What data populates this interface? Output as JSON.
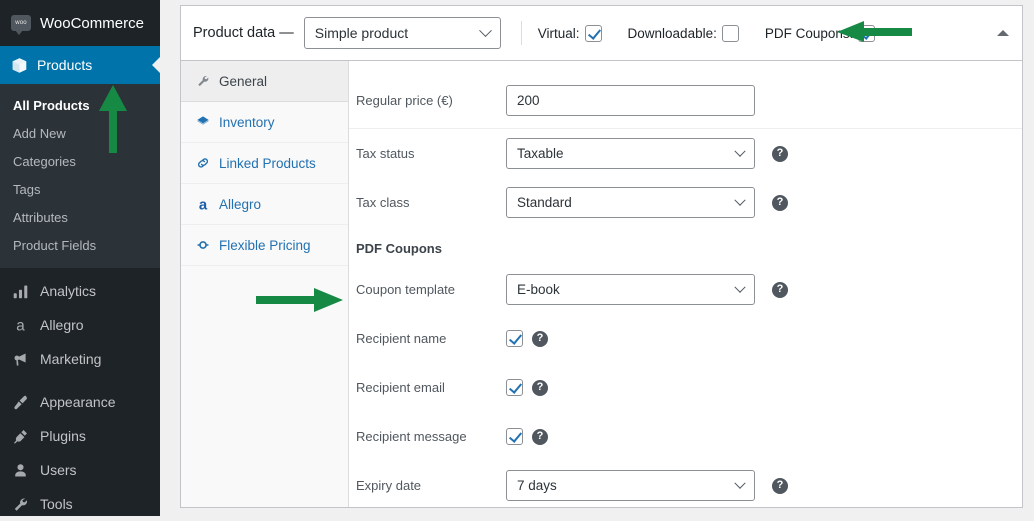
{
  "sidebar": {
    "brand": {
      "label": "WooCommerce",
      "icon": "woo-logo",
      "logo_text": "woo"
    },
    "products": {
      "label": "Products",
      "icon": "cube-icon"
    },
    "submenu": [
      {
        "label": "All Products",
        "current": true
      },
      {
        "label": "Add New",
        "current": false
      },
      {
        "label": "Categories",
        "current": false
      },
      {
        "label": "Tags",
        "current": false
      },
      {
        "label": "Attributes",
        "current": false
      },
      {
        "label": "Product Fields",
        "current": false
      }
    ],
    "items": [
      {
        "label": "Analytics",
        "icon": "bar-chart-icon"
      },
      {
        "label": "Allegro",
        "icon": "allegro-a-icon"
      },
      {
        "label": "Marketing",
        "icon": "megaphone-icon"
      },
      {
        "label": "Appearance",
        "icon": "paintbrush-icon"
      },
      {
        "label": "Plugins",
        "icon": "plug-icon"
      },
      {
        "label": "Users",
        "icon": "user-icon"
      },
      {
        "label": "Tools",
        "icon": "wrench-icon"
      }
    ]
  },
  "panel": {
    "header": {
      "title": "Product data —",
      "product_type": "Simple product",
      "checkboxes": [
        {
          "label": "Virtual:",
          "checked": true
        },
        {
          "label": "Downloadable:",
          "checked": false
        },
        {
          "label": "PDF Coupons:",
          "checked": true
        }
      ],
      "collapse_icon": "triangle-up-icon"
    },
    "tabs": [
      {
        "label": "General",
        "icon": "wrench-icon",
        "active": true
      },
      {
        "label": "Inventory",
        "icon": "box-icon",
        "active": false
      },
      {
        "label": "Linked Products",
        "icon": "link-icon",
        "active": false
      },
      {
        "label": "Allegro",
        "icon": "allegro-a-icon",
        "active": false
      },
      {
        "label": "Flexible Pricing",
        "icon": "refresh-icon",
        "active": false
      }
    ],
    "fields": {
      "regular_price": {
        "label": "Regular price (€)",
        "value": "200"
      },
      "tax_status": {
        "label": "Tax status",
        "value": "Taxable",
        "help": "?"
      },
      "tax_class": {
        "label": "Tax class",
        "value": "Standard",
        "help": "?"
      },
      "pdf_coupons_section": "PDF Coupons",
      "coupon_template": {
        "label": "Coupon template",
        "value": "E-book",
        "help": "?"
      },
      "recipient_name": {
        "label": "Recipient name",
        "checked": true,
        "help": "?"
      },
      "recipient_email": {
        "label": "Recipient email",
        "checked": true,
        "help": "?"
      },
      "recipient_message": {
        "label": "Recipient message",
        "checked": true,
        "help": "?"
      },
      "expiry_date": {
        "label": "Expiry date",
        "value": "7 days",
        "help": "?"
      }
    }
  },
  "annotations": {
    "arrow_color": "#168a45",
    "arrows": [
      {
        "name": "arrow-up-all-products",
        "direction": "up"
      },
      {
        "name": "arrow-right-coupon-template",
        "direction": "right"
      },
      {
        "name": "arrow-left-pdf-coupons",
        "direction": "left"
      }
    ]
  },
  "colors": {
    "sidebar_bg": "#1d2327",
    "sidebar_submenu_bg": "#2c3338",
    "accent_blue": "#0073aa",
    "link_blue": "#2271b1",
    "page_bg": "#f0f0f1"
  }
}
